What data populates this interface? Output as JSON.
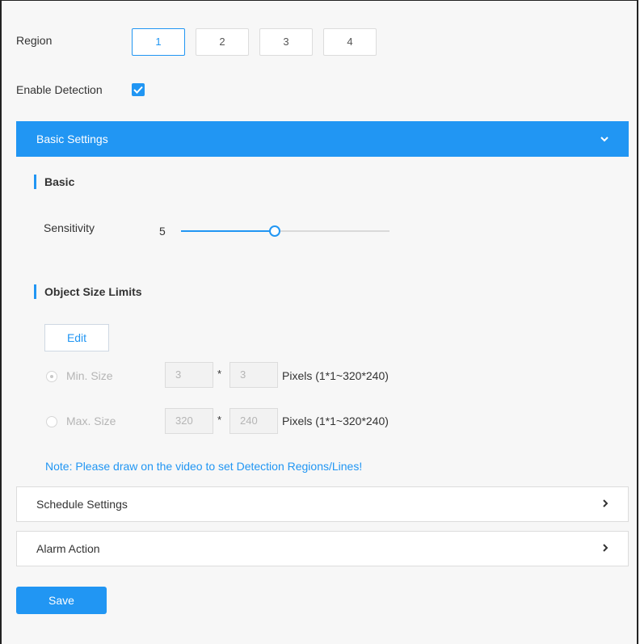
{
  "region": {
    "label": "Region",
    "buttons": [
      "1",
      "2",
      "3",
      "4"
    ],
    "selected": "1"
  },
  "enable_detection": {
    "label": "Enable Detection",
    "checked": true
  },
  "basic_settings": {
    "title": "Basic Settings",
    "expanded": true,
    "basic": {
      "heading": "Basic",
      "sensitivity_label": "Sensitivity",
      "sensitivity_value": "5",
      "slider_fraction": 0.45
    },
    "object_size": {
      "heading": "Object Size Limits",
      "edit_label": "Edit",
      "min": {
        "label": "Min. Size",
        "width": "3",
        "height": "3",
        "range": "Pixels (1*1~320*240)",
        "selected": true
      },
      "max": {
        "label": "Max. Size",
        "width": "320",
        "height": "240",
        "range": "Pixels (1*1~320*240)",
        "selected": false
      },
      "separator": "*"
    },
    "note": "Note: Please draw on the video to set Detection Regions/Lines!"
  },
  "schedule_settings": {
    "title": "Schedule Settings"
  },
  "alarm_action": {
    "title": "Alarm Action"
  },
  "save_label": "Save",
  "colors": {
    "accent": "#2196f3",
    "background": "#f7f7f7"
  },
  "icons": {
    "expanded": "chevron-down-icon",
    "collapsed": "chevron-right-icon",
    "check": "check-icon"
  }
}
